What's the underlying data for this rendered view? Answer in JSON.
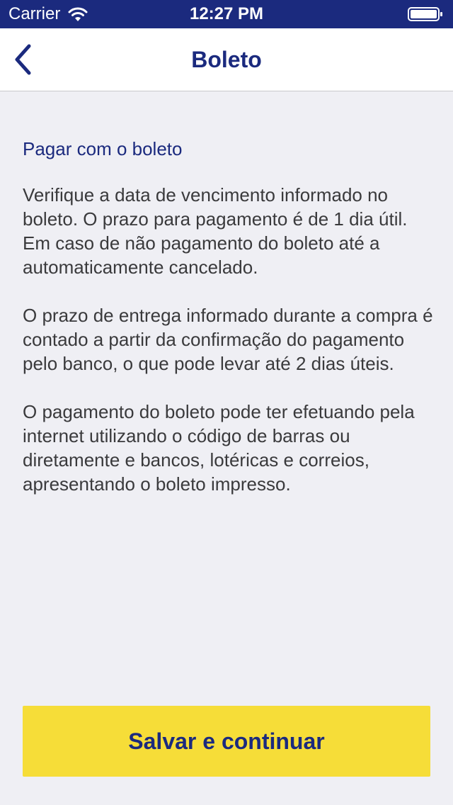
{
  "status_bar": {
    "carrier": "Carrier",
    "time": "12:27 PM",
    "icons": [
      "wifi-icon",
      "battery-icon"
    ]
  },
  "nav": {
    "title": "Boleto",
    "back_icon": "chevron-left-icon"
  },
  "content": {
    "section_title": "Pagar com o boleto",
    "paragraphs": [
      "Verifique a data de vencimento informado no boleto. O prazo para pagamento é de 1 dia útil. Em caso de não pagamento do boleto até a automaticamente cancelado.",
      "O prazo de entrega informado durante a compra é contado a partir da confirmação do pagamento pelo banco, o que pode levar até 2 dias úteis.",
      "O pagamento do boleto pode ter efetuando pela internet utilizando o código de barras ou diretamente e bancos, lotéricas e correios, apresentando o boleto impresso."
    ]
  },
  "footer": {
    "save_label": "Salvar e continuar"
  },
  "colors": {
    "brand_navy": "#1b2a7e",
    "accent_yellow": "#f6dd38",
    "background": "#efeff4"
  }
}
